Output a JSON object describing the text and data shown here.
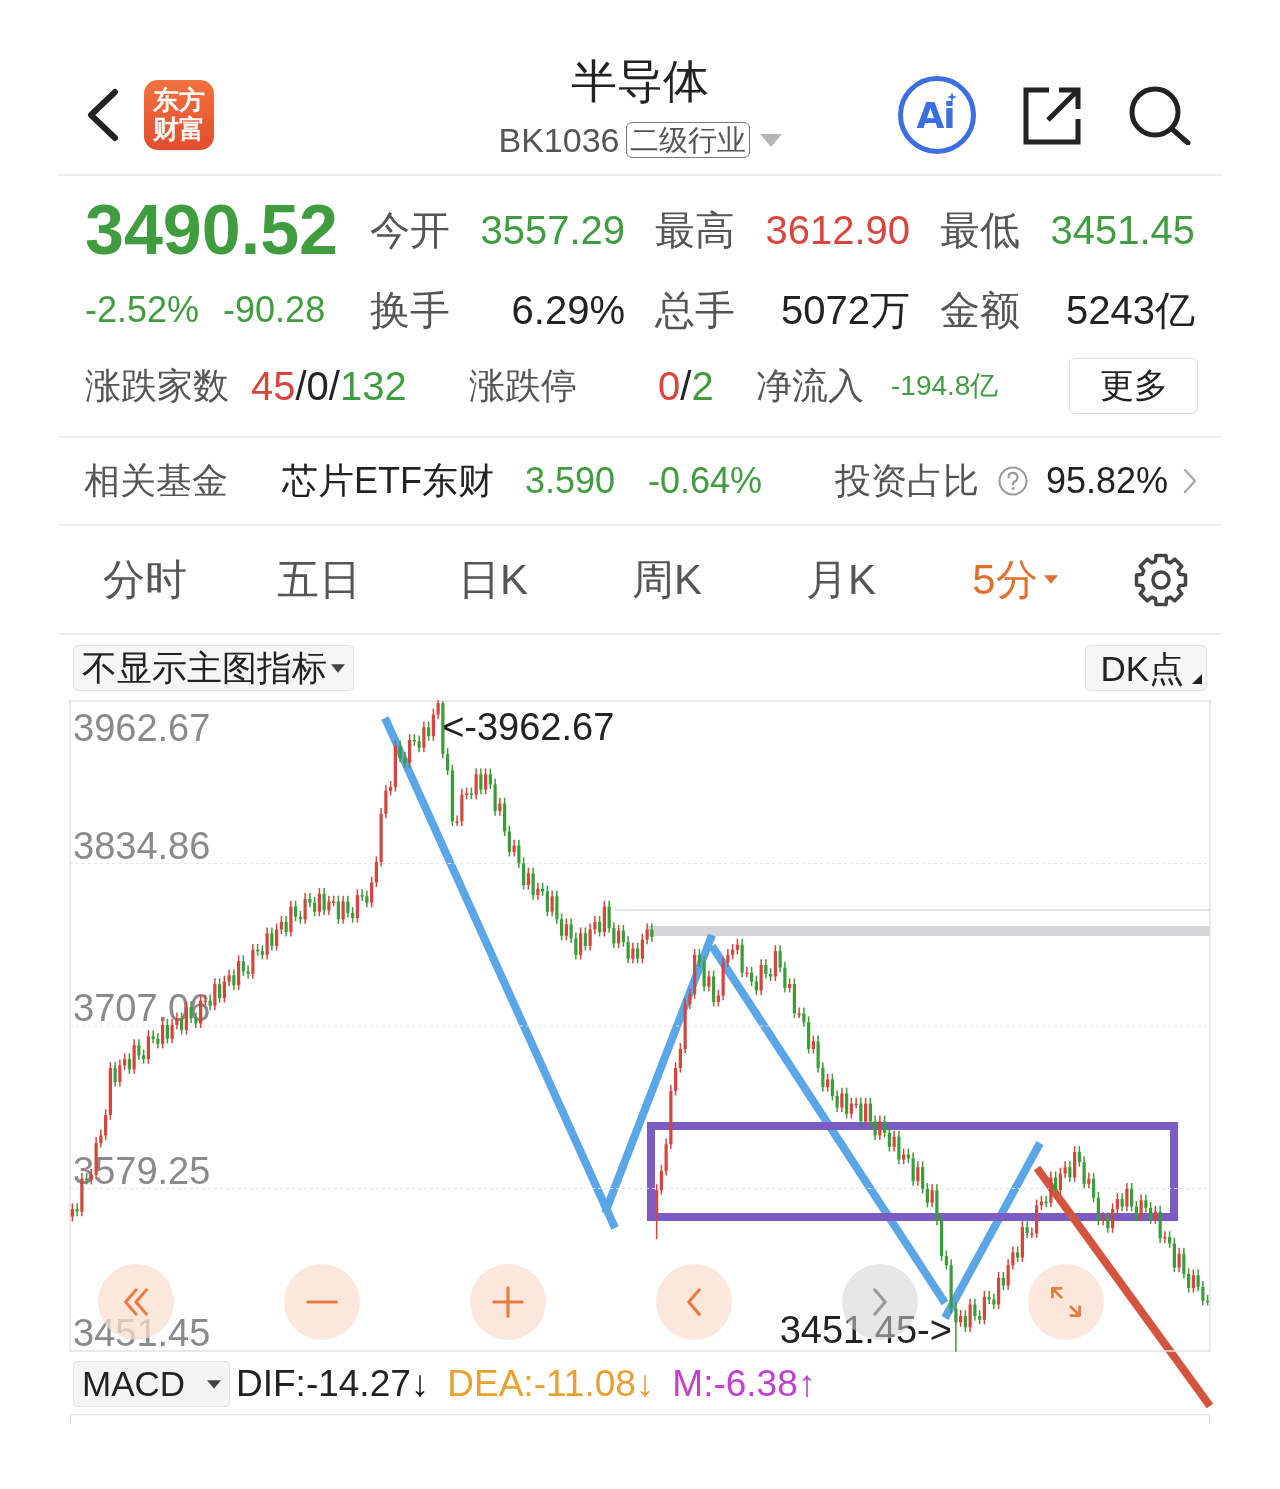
{
  "header": {
    "logo": "东方财富",
    "title": "半导体",
    "code": "BK1036",
    "category": "二级行业",
    "ai_button": "Ai"
  },
  "quote": {
    "price": "3490.52",
    "change_percent": "-2.52%",
    "change": "-90.28",
    "color": "#3f9c3f",
    "stats": [
      {
        "label": "今开",
        "value": "3557.29",
        "color": "#3f9c3f"
      },
      {
        "label": "最高",
        "value": "3612.90",
        "color": "#d8453d"
      },
      {
        "label": "最低",
        "value": "3451.45",
        "color": "#3f9c3f"
      },
      {
        "label": "换手",
        "value": "6.29%",
        "color": "#222222"
      },
      {
        "label": "总手",
        "value": "5072万",
        "color": "#222222"
      },
      {
        "label": "金额",
        "value": "5243亿",
        "color": "#222222"
      }
    ],
    "breadth": {
      "label": "涨跌家数",
      "parts": [
        {
          "text": "45",
          "color": "#d8453d"
        },
        {
          "text": "/0/",
          "color": "#222222"
        },
        {
          "text": "132",
          "color": "#3f9c3f"
        }
      ]
    },
    "limit": {
      "label": "涨跌停",
      "parts": [
        {
          "text": "0",
          "color": "#d8453d"
        },
        {
          "text": "/",
          "color": "#222222"
        },
        {
          "text": "2",
          "color": "#3f9c3f"
        }
      ]
    },
    "net_inflow": {
      "label": "净流入",
      "value": "-194.8亿",
      "color": "#3f9c3f"
    },
    "more_button": "更多"
  },
  "related_fund": {
    "label": "相关基金",
    "name": "芯片ETF东财",
    "price": "3.590",
    "change": "-0.64%",
    "color": "#3f9c3f",
    "weight_label": "投资占比",
    "weight": "95.82%"
  },
  "period_tabs": [
    {
      "label": "分时",
      "selected": false,
      "dropdown": false
    },
    {
      "label": "五日",
      "selected": false,
      "dropdown": false
    },
    {
      "label": "日K",
      "selected": false,
      "dropdown": false
    },
    {
      "label": "周K",
      "selected": false,
      "dropdown": false
    },
    {
      "label": "月K",
      "selected": false,
      "dropdown": false
    },
    {
      "label": "5分",
      "selected": true,
      "dropdown": true
    }
  ],
  "chart": {
    "indicator_button": "不显示主图指标",
    "dk_button": "DK点",
    "range_high_label": "3962.67",
    "chart_data": {
      "type": "candlestick",
      "ylim": [
        3451.45,
        3962.67
      ],
      "yticks": [
        3834.86,
        3707.06,
        3579.25,
        3451.45
      ],
      "grid": true,
      "ohlc": [
        [
          3557.29,
          3567,
          3554,
          3563
        ],
        [
          3563,
          3567,
          3558,
          3561
        ],
        [
          3561,
          3591,
          3558,
          3587
        ],
        [
          3587,
          3591,
          3583,
          3586
        ],
        [
          3586,
          3594,
          3583,
          3590
        ],
        [
          3590,
          3619,
          3587,
          3615
        ],
        [
          3615,
          3625,
          3612,
          3621
        ],
        [
          3621,
          3641,
          3618,
          3637
        ],
        [
          3637,
          3678,
          3634,
          3674
        ],
        [
          3674,
          3678,
          3660,
          3663
        ],
        [
          3663,
          3680,
          3660,
          3676
        ],
        [
          3676,
          3685,
          3673,
          3681
        ],
        [
          3681,
          3685,
          3670,
          3673
        ],
        [
          3673,
          3696,
          3670,
          3692
        ],
        [
          3692,
          3696,
          3681,
          3684
        ],
        [
          3684,
          3688,
          3678,
          3681
        ],
        [
          3681,
          3703,
          3678,
          3699
        ],
        [
          3699,
          3703,
          3694,
          3697
        ],
        [
          3697,
          3701,
          3690,
          3693
        ],
        [
          3693,
          3712,
          3690,
          3708
        ],
        [
          3708,
          3712,
          3694,
          3697
        ],
        [
          3697,
          3712,
          3694,
          3708
        ],
        [
          3708,
          3717,
          3705,
          3713
        ],
        [
          3713,
          3717,
          3701,
          3704
        ],
        [
          3704,
          3726,
          3701,
          3722
        ],
        [
          3722,
          3726,
          3710,
          3713
        ],
        [
          3713,
          3717,
          3706,
          3709
        ],
        [
          3709,
          3731,
          3706,
          3727
        ],
        [
          3727,
          3731,
          3724,
          3727
        ],
        [
          3727,
          3731,
          3720,
          3723
        ],
        [
          3723,
          3744,
          3720,
          3740
        ],
        [
          3740,
          3744,
          3726,
          3729
        ],
        [
          3729,
          3746,
          3726,
          3742
        ],
        [
          3742,
          3751,
          3739,
          3747
        ],
        [
          3747,
          3751,
          3736,
          3739
        ],
        [
          3739,
          3762,
          3736,
          3758
        ],
        [
          3758,
          3762,
          3747,
          3750
        ],
        [
          3750,
          3754,
          3745,
          3748
        ],
        [
          3748,
          3771,
          3745,
          3767
        ],
        [
          3767,
          3771,
          3763,
          3766
        ],
        [
          3766,
          3770,
          3760,
          3763
        ],
        [
          3763,
          3784,
          3760,
          3780
        ],
        [
          3780,
          3784,
          3767,
          3770
        ],
        [
          3770,
          3787,
          3767,
          3783
        ],
        [
          3783,
          3793,
          3780,
          3789
        ],
        [
          3789,
          3793,
          3778,
          3781
        ],
        [
          3781,
          3805,
          3778,
          3801
        ],
        [
          3801,
          3805,
          3790,
          3793
        ],
        [
          3793,
          3797,
          3788,
          3791
        ],
        [
          3791,
          3811,
          3788,
          3807
        ],
        [
          3807,
          3811,
          3801,
          3804
        ],
        [
          3804,
          3808,
          3794,
          3797
        ],
        [
          3797,
          3815,
          3794,
          3811
        ],
        [
          3811,
          3815,
          3795,
          3798
        ],
        [
          3798,
          3809,
          3795,
          3805
        ],
        [
          3805,
          3809,
          3802,
          3805
        ],
        [
          3805,
          3809,
          3788,
          3791
        ],
        [
          3791,
          3809,
          3788,
          3805
        ],
        [
          3805,
          3809,
          3793,
          3796
        ],
        [
          3796,
          3800,
          3789,
          3792
        ],
        [
          3792,
          3814,
          3789,
          3810
        ],
        [
          3810,
          3814,
          3806,
          3809
        ],
        [
          3809,
          3813,
          3801,
          3804
        ],
        [
          3804,
          3824,
          3801,
          3820
        ],
        [
          3820,
          3840,
          3817,
          3836
        ],
        [
          3836,
          3878,
          3833,
          3874
        ],
        [
          3874,
          3896,
          3871,
          3892
        ],
        [
          3892,
          3899,
          3889,
          3895
        ],
        [
          3895,
          3931,
          3892,
          3927
        ],
        [
          3927,
          3931,
          3915,
          3918
        ],
        [
          3918,
          3922,
          3911,
          3914
        ],
        [
          3914,
          3936,
          3911,
          3932
        ],
        [
          3932,
          3936,
          3928,
          3931
        ],
        [
          3931,
          3935,
          3923,
          3926
        ],
        [
          3926,
          3946,
          3923,
          3942
        ],
        [
          3942,
          3946,
          3932,
          3935
        ],
        [
          3935,
          3956,
          3932,
          3952
        ],
        [
          3952,
          3962.67,
          3949,
          3961
        ],
        [
          3961,
          3962,
          3918,
          3921
        ],
        [
          3921,
          3925,
          3905,
          3908
        ],
        [
          3908,
          3912,
          3865,
          3868
        ],
        [
          3868,
          3872,
          3865,
          3868
        ],
        [
          3868,
          3893,
          3865,
          3889
        ],
        [
          3889,
          3894,
          3886,
          3890
        ],
        [
          3890,
          3894,
          3886,
          3889
        ],
        [
          3889,
          3909,
          3886,
          3905
        ],
        [
          3905,
          3909,
          3890,
          3893
        ],
        [
          3893,
          3909,
          3890,
          3905
        ],
        [
          3905,
          3909,
          3894,
          3897
        ],
        [
          3897,
          3901,
          3873,
          3876
        ],
        [
          3876,
          3886,
          3873,
          3882
        ],
        [
          3882,
          3886,
          3857,
          3860
        ],
        [
          3860,
          3864,
          3841,
          3844
        ],
        [
          3844,
          3853,
          3841,
          3849
        ],
        [
          3849,
          3853,
          3832,
          3835
        ],
        [
          3835,
          3839,
          3815,
          3818
        ],
        [
          3818,
          3831,
          3815,
          3827
        ],
        [
          3827,
          3831,
          3807,
          3810
        ],
        [
          3810,
          3819,
          3807,
          3815
        ],
        [
          3815,
          3819,
          3810,
          3813
        ],
        [
          3813,
          3817,
          3794,
          3797
        ],
        [
          3797,
          3813,
          3794,
          3809
        ],
        [
          3809,
          3813,
          3788,
          3791
        ],
        [
          3791,
          3795,
          3775,
          3778
        ],
        [
          3778,
          3791,
          3775,
          3787
        ],
        [
          3787,
          3791,
          3773,
          3776
        ],
        [
          3776,
          3780,
          3760,
          3763
        ],
        [
          3763,
          3784,
          3760,
          3780
        ],
        [
          3780,
          3784,
          3767,
          3770
        ],
        [
          3770,
          3787,
          3767,
          3783
        ],
        [
          3783,
          3793,
          3780,
          3789
        ],
        [
          3789,
          3793,
          3778,
          3781
        ],
        [
          3781,
          3805,
          3778,
          3801
        ],
        [
          3801,
          3805,
          3781,
          3784
        ],
        [
          3784,
          3788,
          3769,
          3772
        ],
        [
          3772,
          3786,
          3769,
          3782
        ],
        [
          3782,
          3786,
          3770,
          3773
        ],
        [
          3773,
          3777,
          3757,
          3760
        ],
        [
          3760,
          3772,
          3757,
          3768
        ],
        [
          3768,
          3772,
          3757,
          3760
        ],
        [
          3760,
          3779,
          3757,
          3775
        ],
        [
          3775,
          3787,
          3772,
          3783
        ],
        [
          3783,
          3787,
          3774,
          3777
        ],
        [
          3560,
          3582,
          3540,
          3578
        ],
        [
          3578,
          3597,
          3575,
          3593
        ],
        [
          3593,
          3618,
          3590,
          3614
        ],
        [
          3614,
          3660,
          3611,
          3656
        ],
        [
          3656,
          3678,
          3653,
          3674
        ],
        [
          3674,
          3693,
          3671,
          3689
        ],
        [
          3689,
          3728,
          3686,
          3724
        ],
        [
          3724,
          3736,
          3721,
          3732
        ],
        [
          3732,
          3767,
          3729,
          3763
        ],
        [
          3763,
          3767,
          3754,
          3757
        ],
        [
          3757,
          3761,
          3735,
          3738
        ],
        [
          3738,
          3750,
          3735,
          3746
        ],
        [
          3746,
          3750,
          3723,
          3726
        ],
        [
          3726,
          3735,
          3723,
          3731
        ],
        [
          3731,
          3761,
          3728,
          3757
        ],
        [
          3757,
          3767,
          3754,
          3763
        ],
        [
          3763,
          3771,
          3760,
          3767
        ],
        [
          3767,
          3775,
          3764,
          3771
        ],
        [
          3771,
          3775,
          3746,
          3749
        ],
        [
          3749,
          3753,
          3746,
          3749
        ],
        [
          3749,
          3753,
          3739,
          3742
        ],
        [
          3742,
          3746,
          3732,
          3735
        ],
        [
          3735,
          3759,
          3732,
          3755
        ],
        [
          3755,
          3759,
          3745,
          3748
        ],
        [
          3748,
          3752,
          3743,
          3746
        ],
        [
          3746,
          3770,
          3743,
          3766
        ],
        [
          3766,
          3770,
          3750,
          3753
        ],
        [
          3753,
          3757,
          3734,
          3737
        ],
        [
          3737,
          3744,
          3734,
          3740
        ],
        [
          3740,
          3744,
          3714,
          3717
        ],
        [
          3717,
          3721,
          3714,
          3717
        ],
        [
          3717,
          3721,
          3707,
          3710
        ],
        [
          3710,
          3714,
          3686,
          3689
        ],
        [
          3689,
          3699,
          3686,
          3695
        ],
        [
          3695,
          3699,
          3671,
          3674
        ],
        [
          3674,
          3678,
          3656,
          3659
        ],
        [
          3659,
          3669,
          3656,
          3665
        ],
        [
          3665,
          3669,
          3649,
          3652
        ],
        [
          3652,
          3656,
          3640,
          3643
        ],
        [
          3643,
          3658,
          3640,
          3654
        ],
        [
          3654,
          3658,
          3635,
          3638
        ],
        [
          3638,
          3650,
          3635,
          3646
        ],
        [
          3646,
          3650,
          3643,
          3646
        ],
        [
          3646,
          3650,
          3629,
          3632
        ],
        [
          3632,
          3650,
          3629,
          3646
        ],
        [
          3646,
          3650,
          3629,
          3632
        ],
        [
          3632,
          3636,
          3618,
          3621
        ],
        [
          3621,
          3636,
          3618,
          3632
        ],
        [
          3632,
          3636,
          3620,
          3623
        ],
        [
          3623,
          3627,
          3609,
          3612
        ],
        [
          3612,
          3624,
          3609,
          3620
        ],
        [
          3620,
          3624,
          3599,
          3602
        ],
        [
          3602,
          3610,
          3599,
          3606
        ],
        [
          3606,
          3610,
          3600,
          3603
        ],
        [
          3603,
          3607,
          3582,
          3585
        ],
        [
          3585,
          3600,
          3582,
          3596
        ],
        [
          3596,
          3600,
          3576,
          3579
        ],
        [
          3579,
          3583,
          3565,
          3568
        ],
        [
          3568,
          3582,
          3565,
          3578
        ],
        [
          3578,
          3582,
          3551,
          3554
        ],
        [
          3554,
          3558,
          3523,
          3526
        ],
        [
          3526,
          3530,
          3516,
          3519
        ],
        [
          3519,
          3523,
          3482,
          3485
        ],
        [
          3485,
          3489,
          3451.45,
          3474
        ],
        [
          3474,
          3483,
          3471,
          3479
        ],
        [
          3479,
          3483,
          3467,
          3470
        ],
        [
          3470,
          3492,
          3467,
          3488
        ],
        [
          3488,
          3492,
          3476,
          3479
        ],
        [
          3479,
          3483,
          3473,
          3476
        ],
        [
          3476,
          3498,
          3473,
          3494
        ],
        [
          3494,
          3498,
          3489,
          3492
        ],
        [
          3492,
          3496,
          3485,
          3488
        ],
        [
          3488,
          3513,
          3485,
          3509
        ],
        [
          3509,
          3513,
          3500,
          3503
        ],
        [
          3503,
          3523,
          3500,
          3519
        ],
        [
          3519,
          3533,
          3516,
          3529
        ],
        [
          3529,
          3533,
          3522,
          3525
        ],
        [
          3525,
          3553,
          3522,
          3549
        ],
        [
          3549,
          3553,
          3541,
          3544
        ],
        [
          3544,
          3548,
          3541,
          3544
        ],
        [
          3544,
          3570,
          3541,
          3566
        ],
        [
          3566,
          3573,
          3563,
          3569
        ],
        [
          3569,
          3573,
          3565,
          3568
        ],
        [
          3568,
          3592,
          3565,
          3588
        ],
        [
          3588,
          3592,
          3575,
          3578
        ],
        [
          3578,
          3595,
          3575,
          3591
        ],
        [
          3591,
          3600,
          3588,
          3596
        ],
        [
          3596,
          3600,
          3585,
          3588
        ],
        [
          3588,
          3612,
          3585,
          3608
        ],
        [
          3608,
          3612,
          3597,
          3600
        ],
        [
          3600,
          3604,
          3580,
          3583
        ],
        [
          3583,
          3591,
          3580,
          3587
        ],
        [
          3587,
          3591,
          3569,
          3572
        ],
        [
          3572,
          3576,
          3551,
          3554
        ],
        [
          3554,
          3560,
          3551,
          3556
        ],
        [
          3556,
          3560,
          3545,
          3548
        ],
        [
          3548,
          3567,
          3545,
          3563
        ],
        [
          3563,
          3575,
          3560,
          3571
        ],
        [
          3571,
          3575,
          3562,
          3565
        ],
        [
          3565,
          3583,
          3562,
          3579
        ],
        [
          3579,
          3583,
          3562,
          3565
        ],
        [
          3565,
          3569,
          3554,
          3557
        ],
        [
          3557,
          3574,
          3554,
          3570
        ],
        [
          3570,
          3574,
          3561,
          3564
        ],
        [
          3564,
          3568,
          3552,
          3555
        ],
        [
          3555,
          3565,
          3552,
          3561
        ],
        [
          3561,
          3565,
          3537,
          3540
        ],
        [
          3540,
          3545,
          3537,
          3541
        ],
        [
          3541,
          3545,
          3533,
          3536
        ],
        [
          3536,
          3540,
          3514,
          3517
        ],
        [
          3517,
          3532,
          3514,
          3528
        ],
        [
          3528,
          3532,
          3509,
          3512
        ],
        [
          3512,
          3516,
          3498,
          3501
        ],
        [
          3501,
          3515,
          3498,
          3511
        ],
        [
          3511,
          3515,
          3499,
          3502
        ],
        [
          3502,
          3506,
          3488,
          3491
        ],
        [
          3491,
          3495,
          3488,
          3490.52
        ]
      ]
    },
    "high_marker": "<-3962.67",
    "low_marker": "3451.45->",
    "controls": [
      {
        "kind": "rewind",
        "disabled": false
      },
      {
        "kind": "zoom_out",
        "disabled": false
      },
      {
        "kind": "zoom_in",
        "disabled": false
      },
      {
        "kind": "previous",
        "disabled": false
      },
      {
        "kind": "next",
        "disabled": true
      },
      {
        "kind": "fullscreen",
        "disabled": false
      }
    ]
  },
  "macd": {
    "selector": "MACD",
    "values": [
      {
        "text": "DIF:-14.27↓",
        "color": "#222222"
      },
      {
        "text": "DEA:-11.08↓",
        "color": "#e8a030"
      },
      {
        "text": "M:-6.38↑",
        "color": "#c040d0"
      }
    ]
  }
}
